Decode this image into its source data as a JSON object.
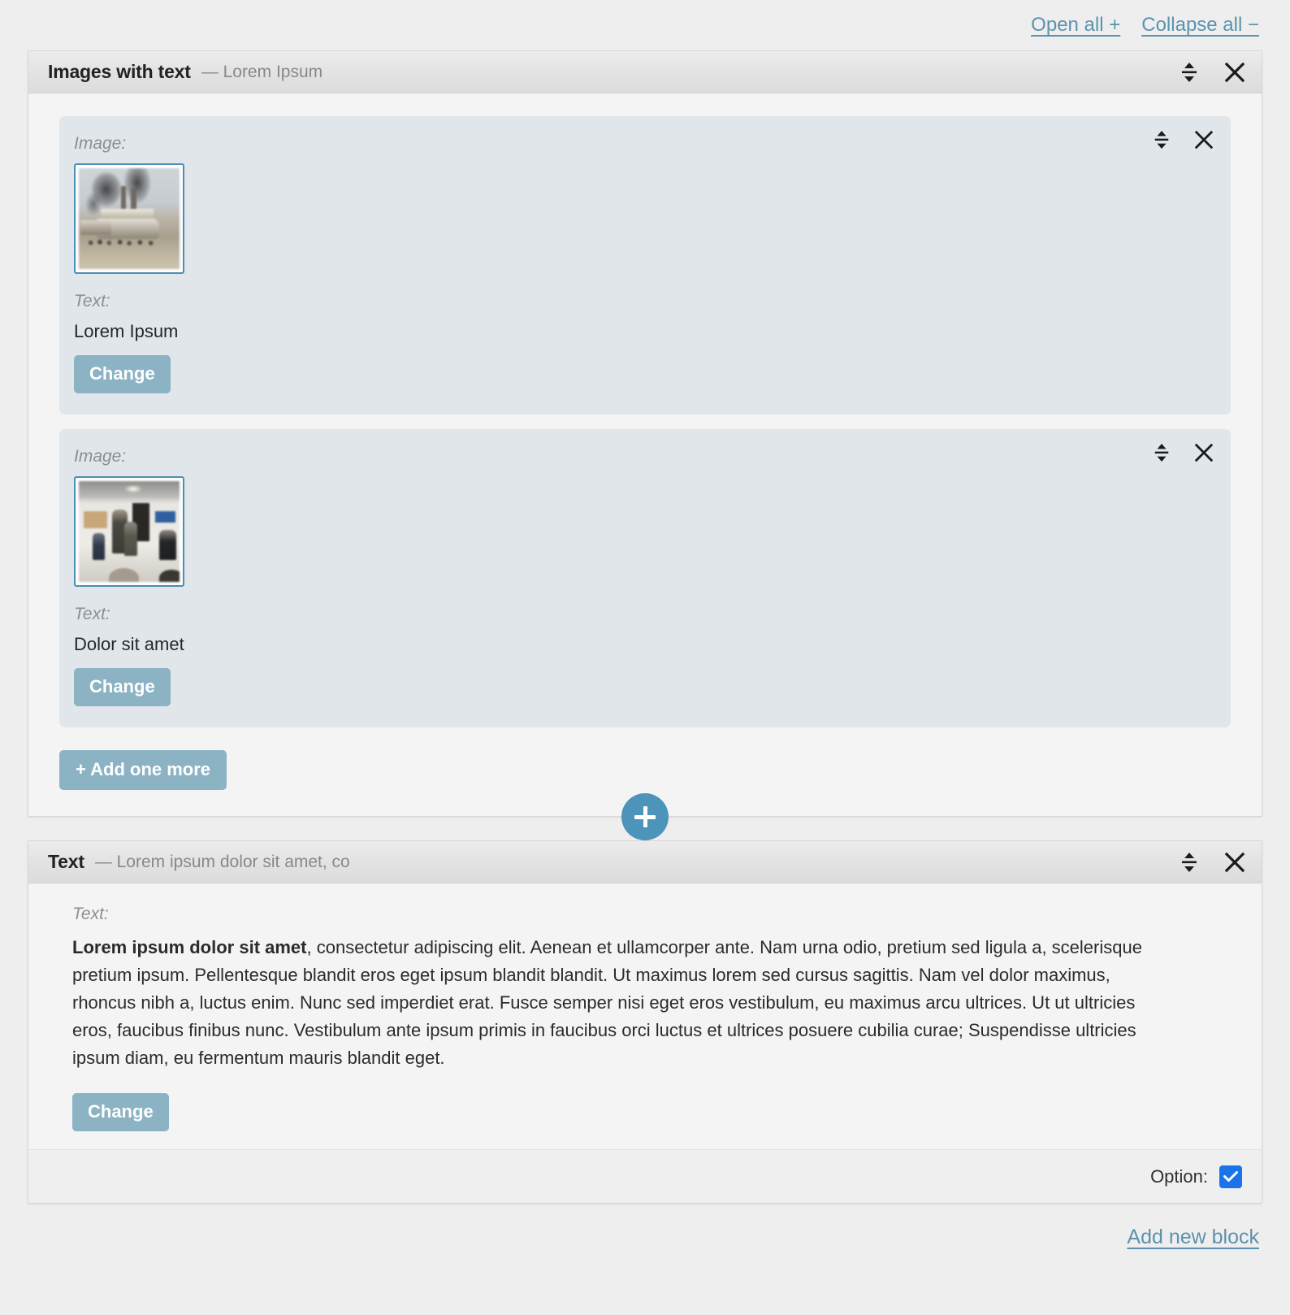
{
  "top_actions": {
    "open_all": "Open all +",
    "collapse_all": "Collapse all −"
  },
  "blocks": [
    {
      "title": "Images with text",
      "subtitle": "— Lorem Ipsum",
      "items": [
        {
          "image_label": "Image:",
          "image_alt": "steamboats with smoke stacks on a riverbank, historical photo",
          "text_label": "Text:",
          "text_value": "Lorem Ipsum",
          "change_label": "Change"
        },
        {
          "image_label": "Image:",
          "image_alt": "group of people standing and seated in a gallery room",
          "text_label": "Text:",
          "text_value": "Dolor sit amet",
          "change_label": "Change"
        }
      ],
      "add_one_more_label": "+ Add one more"
    },
    {
      "title": "Text",
      "subtitle": "— Lorem ipsum dolor sit amet, co",
      "text_label": "Text:",
      "paragraph_bold": "Lorem ipsum dolor sit amet",
      "paragraph_rest": ", consectetur adipiscing elit. Aenean et ullamcorper ante. Nam urna odio, pretium sed ligula a, scelerisque pretium ipsum. Pellentesque blandit eros eget ipsum blandit blandit. Ut maximus lorem sed cursus sagittis. Nam vel dolor maximus, rhoncus nibh a, luctus enim. Nunc sed imperdiet erat. Fusce semper nisi eget eros vestibulum, eu maximus arcu ultrices. Ut ut ultricies eros, faucibus finibus nunc. Vestibulum ante ipsum primis in faucibus orci luctus et ultrices posuere cubilia curae; Suspendisse ultricies ipsum diam, eu fermentum mauris blandit eget.",
      "change_label": "Change",
      "footer": {
        "option_label": "Option:",
        "option_checked": true
      }
    }
  ],
  "add_block_button": "+",
  "bottom_actions": {
    "add_new_block": "Add new block"
  },
  "colors": {
    "link": "#5b93ad",
    "button": "#8cb3c4",
    "round_add": "#4c94b9",
    "checkbox": "#1a73e8",
    "item_card_bg": "#e1e6ea",
    "thumb_border": "#4b8fb3"
  },
  "icons": {
    "move": "move-vertical-icon",
    "close": "close-icon",
    "add": "plus-icon",
    "check": "check-icon"
  }
}
